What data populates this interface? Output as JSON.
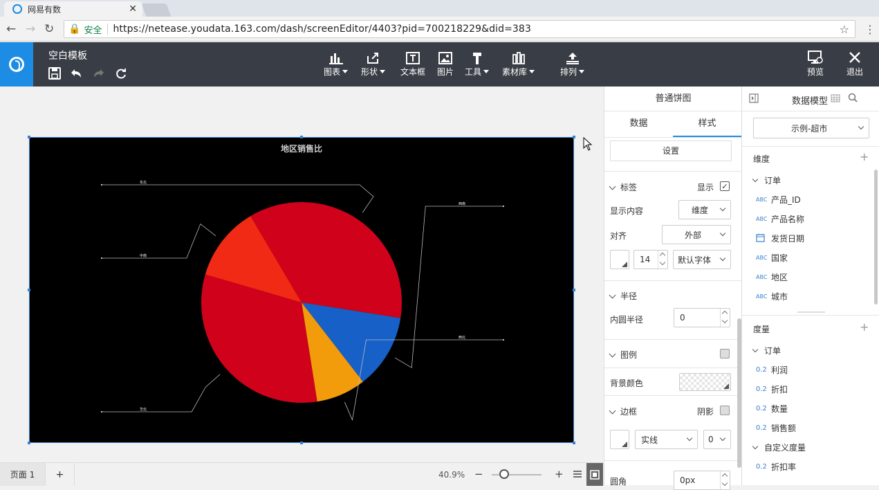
{
  "browser": {
    "tab_title": "网易有数",
    "url": "https://netease.youdata.163.com/dash/screenEditor/4403?pid=700218229&did=383",
    "secure_label": "安全"
  },
  "appbar": {
    "template_name": "空白模板",
    "tools": [
      {
        "label": "图表",
        "icon": "bar-chart-icon",
        "dropdown": true
      },
      {
        "label": "形状",
        "icon": "shape-icon",
        "dropdown": true
      },
      {
        "label": "文本框",
        "icon": "textbox-icon",
        "dropdown": false
      },
      {
        "label": "图片",
        "icon": "image-icon",
        "dropdown": false
      },
      {
        "label": "工具",
        "icon": "hammer-icon",
        "dropdown": true
      },
      {
        "label": "素材库",
        "icon": "library-icon",
        "dropdown": true
      },
      {
        "label": "排列",
        "icon": "arrange-icon",
        "dropdown": true
      }
    ],
    "preview_label": "预览",
    "exit_label": "退出"
  },
  "chart_data": {
    "type": "pie",
    "title": "地区销售比",
    "slices": [
      {
        "label": "东北",
        "value": 36,
        "color": "#d0021b"
      },
      {
        "label": "西南",
        "value": 12,
        "color": "#1660c8"
      },
      {
        "label": "西北",
        "value": 8,
        "color": "#f39c0b"
      },
      {
        "label": "华北",
        "value": 32,
        "color": "#d0021b"
      },
      {
        "label": "中南",
        "value": 12,
        "color": "#f02a14"
      }
    ]
  },
  "bottom": {
    "page_tab": "页面 1",
    "add": "+",
    "zoom": "40.9%",
    "zoom_minus": "−",
    "zoom_plus": "+",
    "zoom_level": 0.25
  },
  "style_panel": {
    "title": "普通饼图",
    "tab_data": "数据",
    "tab_style": "样式",
    "settings_button": "设置",
    "label_section": "标签",
    "show_label": "显示",
    "display_content_label": "显示内容",
    "display_content_value": "维度",
    "align_label": "对齐",
    "align_value": "外部",
    "font_size": "14",
    "font_family": "默认字体",
    "radius_section": "半径",
    "inner_radius_label": "内圆半径",
    "inner_radius_value": "0",
    "legend_section": "图例",
    "bg_color_label": "背景颜色",
    "border_section": "边框",
    "shadow_label": "阴影",
    "border_style": "实线",
    "border_width": "0",
    "corner_label": "圆角",
    "corner_value": "0px"
  },
  "model_panel": {
    "title": "数据模型",
    "dataset": "示例-超市",
    "dimension_label": "维度",
    "dimension_group": "订单",
    "dimensions": [
      {
        "type": "ABC",
        "name": "产品_ID"
      },
      {
        "type": "ABC",
        "name": "产品名称"
      },
      {
        "type": "date",
        "name": "发货日期"
      },
      {
        "type": "ABC",
        "name": "国家"
      },
      {
        "type": "ABC",
        "name": "地区"
      },
      {
        "type": "ABC",
        "name": "城市"
      }
    ],
    "measure_label": "度量",
    "measure_group": "订单",
    "measures": [
      {
        "type": "0.2",
        "name": "利润"
      },
      {
        "type": "0.2",
        "name": "折扣"
      },
      {
        "type": "0.2",
        "name": "数量"
      },
      {
        "type": "0.2",
        "name": "销售额"
      }
    ],
    "custom_group": "自定义度量",
    "custom_measures": [
      {
        "type": "0.2",
        "name": "折扣率"
      }
    ]
  }
}
